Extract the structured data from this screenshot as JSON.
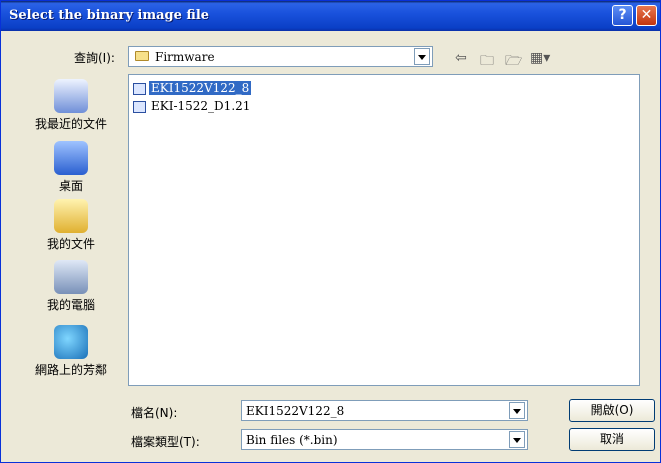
{
  "title": "Select the binary image file",
  "lookin": {
    "label": "查詢(I):",
    "value": "Firmware"
  },
  "places": [
    {
      "label": "我最近的文件"
    },
    {
      "label": "桌面"
    },
    {
      "label": "我的文件"
    },
    {
      "label": "我的電腦"
    },
    {
      "label": "網路上的芳鄰"
    }
  ],
  "files": [
    {
      "name": "EKI1522V122_8",
      "selected": true
    },
    {
      "name": "EKI-1522_D1.21",
      "selected": false
    }
  ],
  "filename": {
    "label": "檔名(N):",
    "value": "EKI1522V122_8"
  },
  "filetype": {
    "label": "檔案類型(T):",
    "value": "Bin files (*.bin)"
  },
  "buttons": {
    "open": "開啟(O)",
    "cancel": "取消"
  },
  "icons": [
    "help-icon",
    "close-icon",
    "folder-icon",
    "back-icon",
    "up-folder-icon",
    "new-folder-icon",
    "views-menu-icon",
    "file-icon"
  ]
}
